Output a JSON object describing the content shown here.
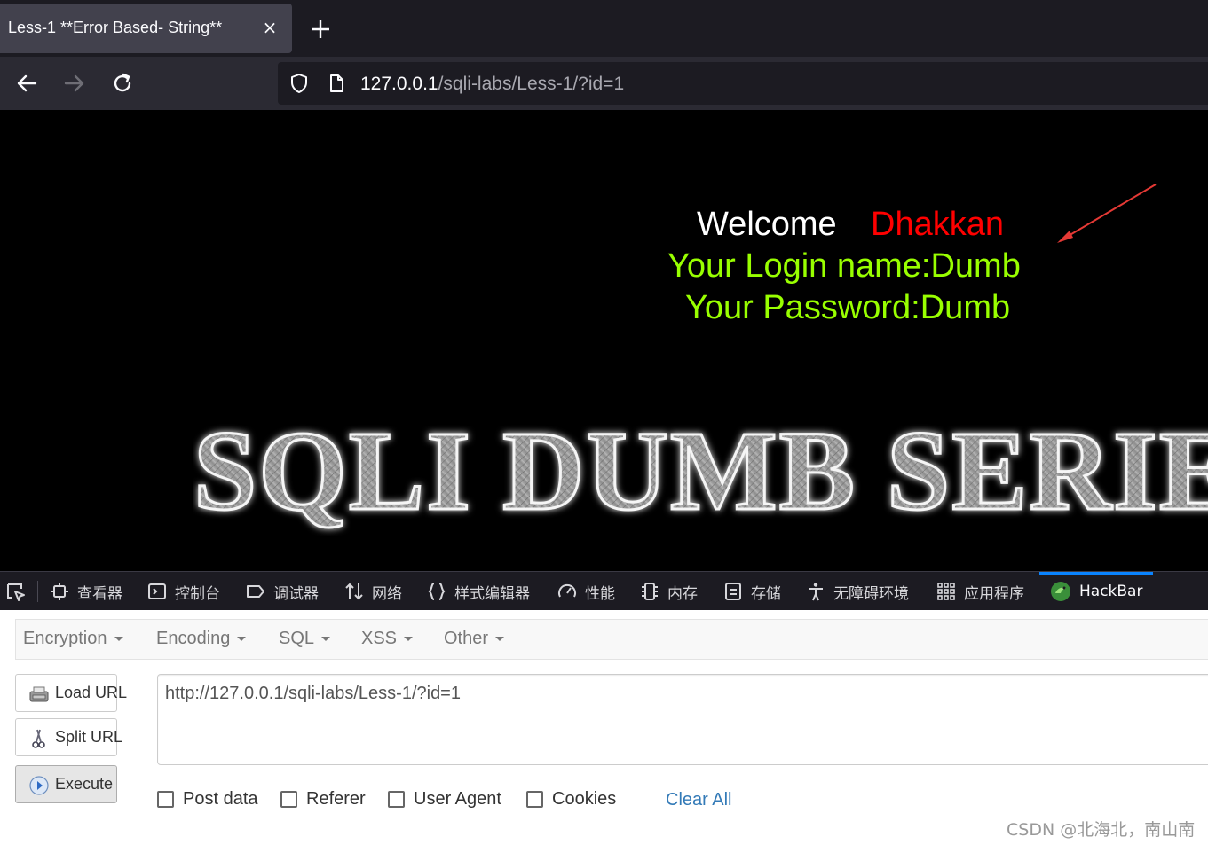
{
  "browser": {
    "tab_title": "Less-1 **Error Based- String**",
    "tab_close": "×",
    "url_host": "127.0.0.1",
    "url_path": "/sqli-labs/Less-1/?id=1"
  },
  "page": {
    "welcome_word": "Welcome",
    "welcome_name": "Dhakkan",
    "login_line": "Your Login name:Dumb",
    "password_line": "Your Password:Dumb",
    "banner_text": "SQLI DUMB SERIES",
    "colors": {
      "welcome": "#ffffff",
      "name": "#ff0000",
      "info": "#99ff00",
      "background": "#000000"
    }
  },
  "devtools": {
    "tabs": [
      {
        "label": "查看器",
        "icon": "inspector-icon"
      },
      {
        "label": "控制台",
        "icon": "console-icon"
      },
      {
        "label": "调试器",
        "icon": "debugger-icon"
      },
      {
        "label": "网络",
        "icon": "network-icon"
      },
      {
        "label": "样式编辑器",
        "icon": "style-editor-icon"
      },
      {
        "label": "性能",
        "icon": "performance-icon"
      },
      {
        "label": "内存",
        "icon": "memory-icon"
      },
      {
        "label": "存储",
        "icon": "storage-icon"
      },
      {
        "label": "无障碍环境",
        "icon": "accessibility-icon"
      },
      {
        "label": "应用程序",
        "icon": "application-icon"
      },
      {
        "label": "HackBar",
        "icon": "hackbar-icon",
        "selected": true
      }
    ]
  },
  "hackbar": {
    "menu": [
      "Encryption",
      "Encoding",
      "SQL",
      "XSS",
      "Other"
    ],
    "buttons": {
      "load_url": "Load URL",
      "split_url": "Split URL",
      "execute": "Execute"
    },
    "url_value": "http://127.0.0.1/sqli-labs/Less-1/?id=1",
    "checkboxes": [
      {
        "label": "Post data",
        "checked": false
      },
      {
        "label": "Referer",
        "checked": false
      },
      {
        "label": "User Agent",
        "checked": false
      },
      {
        "label": "Cookies",
        "checked": false
      }
    ],
    "clear_all": "Clear All"
  },
  "watermark": "CSDN @北海北，南山南"
}
